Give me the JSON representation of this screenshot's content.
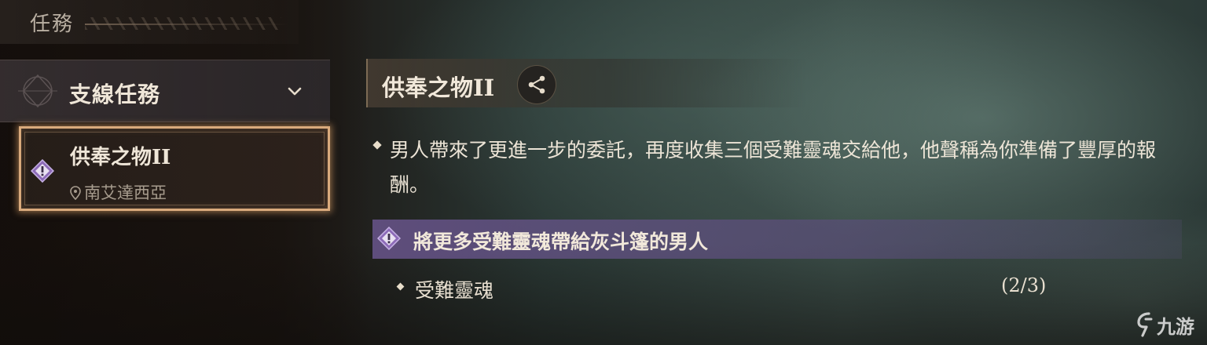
{
  "journal": {
    "title": "任務"
  },
  "category": {
    "label": "支線任務",
    "expanded": true
  },
  "quest_list": [
    {
      "name": "供奉之物II",
      "location": "南艾達西亞",
      "icon": "quest-diamond-exclamation-icon",
      "selected": true
    }
  ],
  "detail": {
    "title": "供奉之物II",
    "share_icon": "share-icon",
    "description": "男人帶來了更進一步的委託，再度收集三個受難靈魂交給他，他聲稱為你準備了豐厚的報酬。",
    "objective": {
      "text": "將更多受難靈魂帶給灰斗篷的男人",
      "icon": "quest-diamond-exclamation-icon",
      "subtasks": [
        {
          "label": "受難靈魂",
          "progress": "(2/3)"
        }
      ]
    }
  },
  "watermark": {
    "text": "九游"
  },
  "colors": {
    "selected_border": "#d9aa7c",
    "objective_bar": "#69558c",
    "quest_icon": "#8d6bb8"
  }
}
